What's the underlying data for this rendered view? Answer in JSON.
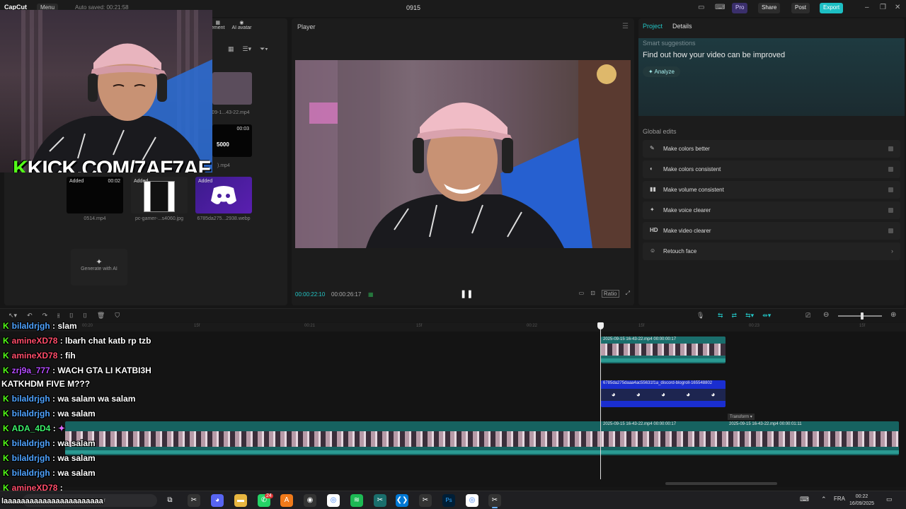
{
  "topbar": {
    "logo": "CapCut",
    "menu_label": "Menu",
    "autosave": "Auto saved: 00:21:58",
    "project_title": "0915",
    "pro_label": "Pro",
    "share_label": "Share",
    "post_label": "Post",
    "export_label": "Export"
  },
  "media": {
    "tabs": [
      "ement",
      "AI avatar"
    ],
    "tiles": [
      {
        "caption": "09-1...43-22.mp4"
      },
      {
        "duration": "00:03",
        "badge": "5000",
        "caption": ").mp4"
      },
      {
        "added": "Added",
        "duration": "00:02",
        "caption": "0514.mp4"
      },
      {
        "added": "Added",
        "caption": "pc-gamer-...s4060.jpg"
      },
      {
        "added": "Added",
        "caption": "6785da275...2938.webp"
      }
    ],
    "generate_label": "Generate with AI"
  },
  "webcam": {
    "banner_k": "K",
    "banner_text": "KICK.COM/7AF7AF"
  },
  "player": {
    "title": "Player",
    "current_time": "00:00:22:10",
    "total_time": "00:00:26:17",
    "ratio_label": "Ratio"
  },
  "right_panel": {
    "tab_project": "Project",
    "tab_details": "Details",
    "smart_label": "Smart suggestions",
    "smart_headline": "Find out how your video can be improved",
    "analyze_label": "Analyze",
    "global_label": "Global edits",
    "edits": [
      {
        "label": "Make colors better",
        "icon": "wand-icon"
      },
      {
        "label": "Make colors consistent",
        "icon": "palette-icon"
      },
      {
        "label": "Make volume consistent",
        "icon": "volume-icon"
      },
      {
        "label": "Make voice clearer",
        "icon": "voice-icon"
      },
      {
        "label": "Make video clearer",
        "icon": "hd-icon",
        "icon_text": "HD"
      },
      {
        "label": "Retouch face",
        "icon": "face-icon"
      }
    ]
  },
  "timeline": {
    "ruler": [
      "00:20",
      "15f",
      "00:21",
      "15f",
      "00:22",
      "15f",
      "00:23",
      "15f"
    ],
    "clip1_label": "2025-09-15 16-43-22.mp4   00:00:00:17",
    "clip2_label": "6785da275daaa4ac55631f1a_discord-blogroll-165548802",
    "clip3_label": "2025-09-15 16-43-22.mp4   00:00:00:17",
    "clip4_label": "2025-09-15 16-43-22.mp4   00:00:01:11",
    "transform_label": "Transform"
  },
  "chat": [
    {
      "user": "bilaldrjgh",
      "color": "#4fa3ff",
      "msg": ": slam"
    },
    {
      "user": "amineXD78",
      "color": "#ff4d6a",
      "msg": ": lbarh chat katb rp tzb"
    },
    {
      "user": "amineXD78",
      "color": "#ff4d6a",
      "msg": ": fih"
    },
    {
      "user": "zrj9a_777",
      "color": "#b54dff",
      "msg": ": WACH GTA LI KATBI3H"
    },
    {
      "user": "",
      "color": "#ffffff",
      "msg": "KATKHDM FIVE M???"
    },
    {
      "user": "bilaldrjgh",
      "color": "#4fa3ff",
      "msg": ": wa salam wa salam"
    },
    {
      "user": "bilaldrjgh",
      "color": "#4fa3ff",
      "msg": ": wa salam"
    },
    {
      "user": "ADA_4D4",
      "color": "#3df06b",
      "msg": ":"
    },
    {
      "user": "bilaldrjgh",
      "color": "#4fa3ff",
      "msg": ": wa salam"
    },
    {
      "user": "bilaldrjgh",
      "color": "#4fa3ff",
      "msg": ": wa salam"
    },
    {
      "user": "bilaldrjgh",
      "color": "#4fa3ff",
      "msg": ": wa salam"
    },
    {
      "user": "amineXD78",
      "color": "#ff4d6a",
      "msg": ":"
    },
    {
      "user": "",
      "color": "#ffffff",
      "msg": "laaaaaaaaaaaaaaaaaaaaaaa"
    }
  ],
  "taskbar": {
    "search_placeholder": "er",
    "lang": "FRA",
    "time": "00:22",
    "date": "16/09/2025",
    "badge": "24"
  },
  "colors": {
    "accent": "#23c6c6",
    "kick_green": "#53fc18",
    "export": "#1dbfc4"
  }
}
